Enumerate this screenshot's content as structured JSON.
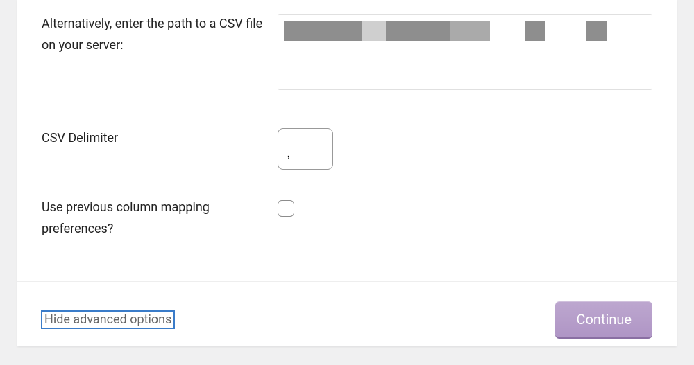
{
  "form": {
    "path": {
      "label": "Alternatively, enter the path to a CSV file on your server:",
      "value": ""
    },
    "delimiter": {
      "label": "CSV Delimiter",
      "value": ","
    },
    "mapping": {
      "label": "Use previous column mapping preferences?"
    }
  },
  "footer": {
    "toggle_label": "Hide advanced options",
    "continue_label": "Continue"
  }
}
